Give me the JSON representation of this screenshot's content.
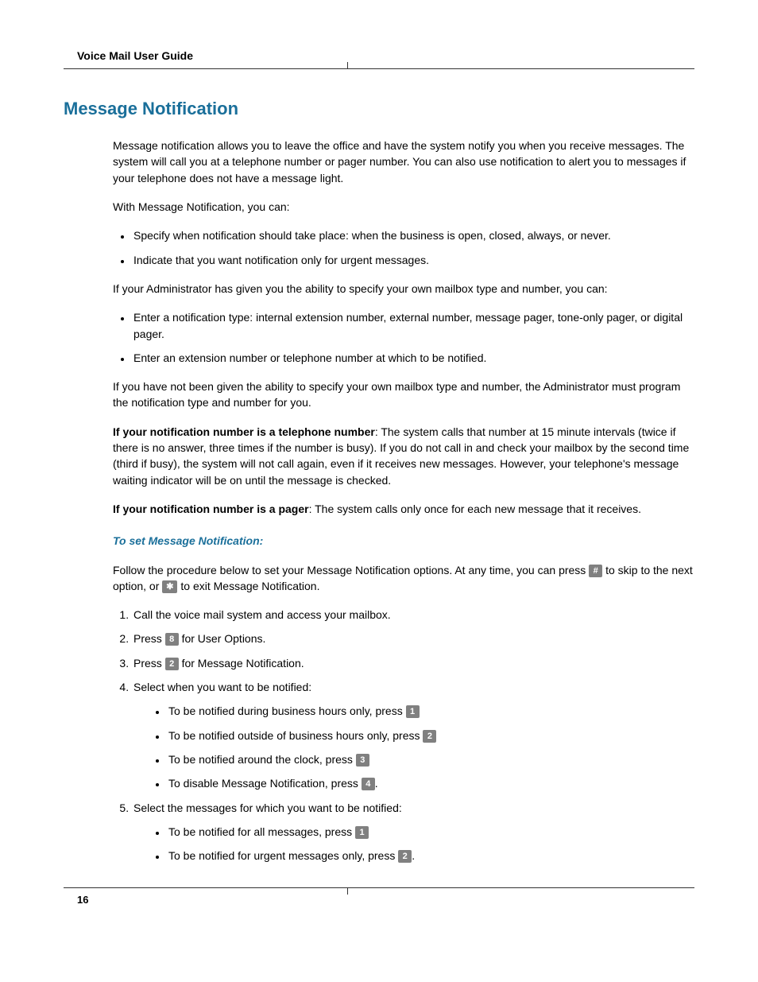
{
  "header": "Voice Mail User Guide",
  "h1": "Message Notification",
  "p1": "Message notification allows you to leave the office and have the system notify you when you receive messages. The system will call you at a telephone number or pager number. You can also use notification to alert you to messages if your telephone does not have a message light.",
  "p2": "With Message Notification, you can:",
  "ul1": {
    "a": "Specify when notification should take place: when the business is open, closed, always, or never.",
    "b": "Indicate that you want notification only for urgent messages."
  },
  "p3": "If your Administrator has given you the ability to specify your own mailbox type and number, you can:",
  "ul2": {
    "a": "Enter a notification type: internal extension number, external number, message pager, tone-only pager, or digital pager.",
    "b": "Enter an extension number or telephone number at which to be notified."
  },
  "p4": "If you have not been given the ability to specify your own mailbox type and number, the Administrator must program the notification type and number for you.",
  "tel_bold": "If your notification number is a telephone number",
  "tel_rest": ": The system calls that number at 15 minute intervals (twice if there is no answer, three times if the number is busy). If you do not call in and check your mailbox by the second time (third if busy), the system will not call again, even if it receives new messages. However, your telephone's message waiting indicator will be on until the message is checked.",
  "pag_bold": "If your notification number is a pager",
  "pag_rest": ": The system calls only once for each new message that it receives.",
  "subh": "To set Message Notification:",
  "proc_intro_a": "Follow the procedure below to set your Message Notification options. At any time, you can press ",
  "proc_intro_b": " to skip to the next option, or ",
  "proc_intro_c": " to exit Message Notification.",
  "keys": {
    "hash": "#",
    "star": "✱",
    "k1": "1",
    "k2": "2",
    "k3": "3",
    "k4": "4",
    "k8": "8"
  },
  "ol": {
    "s1": "Call the voice mail system and access your mailbox.",
    "s2a": "Press ",
    "s2b": " for User Options.",
    "s3a": "Press ",
    "s3b": " for Message Notification.",
    "s4": "Select when you want to be notified:",
    "s4sub": {
      "a1": "To be notified during business hours only, press ",
      "a2": "To be notified outside of business hours only, press ",
      "a3": "To be notified around the clock, press ",
      "a4": "To disable Message Notification, press "
    },
    "s5": "Select the messages for which you want to be notified:",
    "s5sub": {
      "a1": "To be notified for all messages, press ",
      "a2": "To be notified for urgent messages only, press "
    }
  },
  "period": ".",
  "pagenum": "16"
}
